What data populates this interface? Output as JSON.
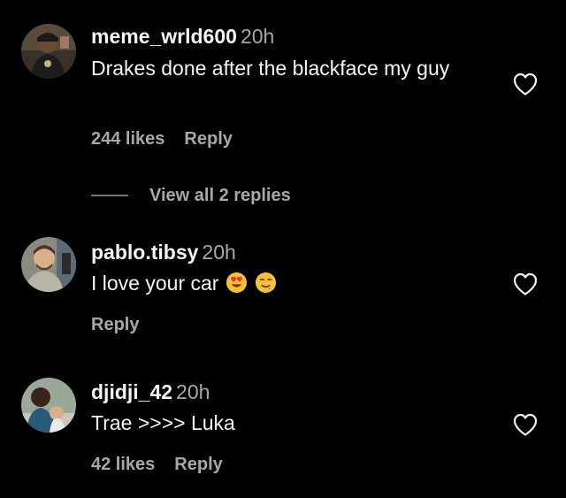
{
  "comments": [
    {
      "username": "meme_wrld600",
      "time": "20h",
      "text": "Drakes done after the blackface my guy",
      "likes": "244 likes",
      "reply": "Reply",
      "avatar_icon": "avatar-photo-icon"
    },
    {
      "username": "pablo.tibsy",
      "time": "20h",
      "text": "I love your car",
      "emojis": [
        "heart-eyes-emoji",
        "drooling-face-emoji"
      ],
      "reply": "Reply",
      "avatar_icon": "avatar-photo-icon"
    },
    {
      "username": "djidji_42",
      "time": "20h",
      "text": "Trae >>>> Luka",
      "likes": "42 likes",
      "reply": "Reply",
      "avatar_icon": "avatar-photo-icon"
    }
  ],
  "replies_toggle": {
    "label": "View all 2 replies"
  },
  "colors": {
    "background": "#000000",
    "primary_text": "#f5f5f5",
    "secondary_text": "#a8a8a8",
    "heart_outline": "#f5f5f5"
  }
}
